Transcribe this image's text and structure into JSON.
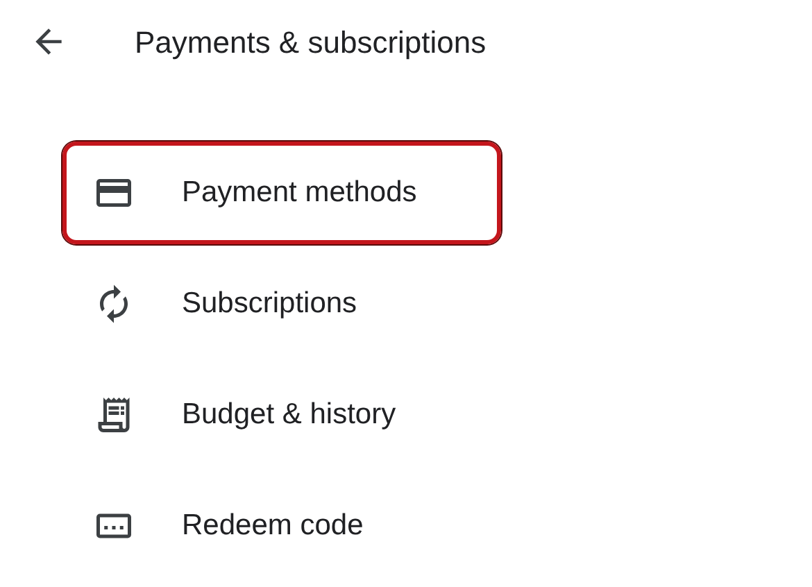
{
  "header": {
    "title": "Payments & subscriptions"
  },
  "items": [
    {
      "kind": "card",
      "label": "Payment methods",
      "highlighted": true
    },
    {
      "kind": "renew",
      "label": "Subscriptions",
      "highlighted": false
    },
    {
      "kind": "receipt",
      "label": "Budget & history",
      "highlighted": false
    },
    {
      "kind": "code",
      "label": "Redeem code",
      "highlighted": false
    }
  ]
}
